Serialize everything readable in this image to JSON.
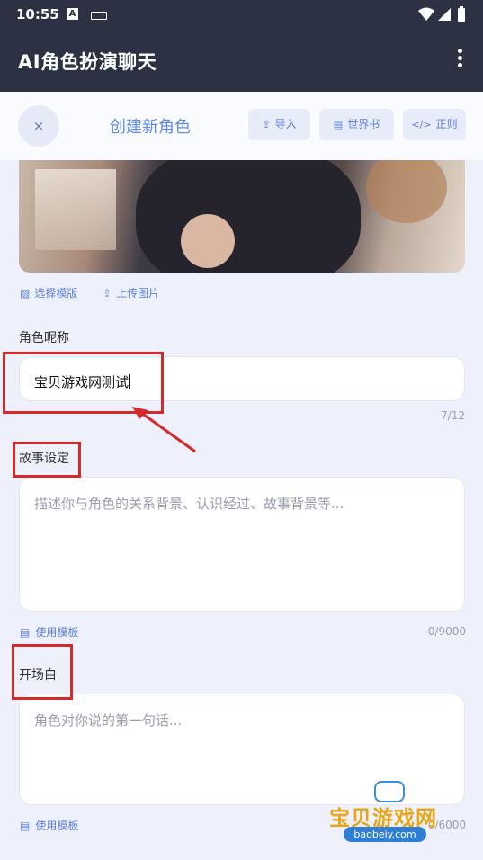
{
  "status": {
    "time": "10:55",
    "badge": "A"
  },
  "appbar": {
    "title": "AI角色扮演聊天"
  },
  "toolbar": {
    "close": "×",
    "title": "创建新角色",
    "import_label": "导入",
    "worldbook_label": "世界书",
    "regex_label": "正则"
  },
  "image_actions": {
    "choose_template": "选择模版",
    "upload": "上传图片"
  },
  "nickname": {
    "label": "角色昵称",
    "value": "宝贝游戏网测试",
    "counter": "7/12"
  },
  "story": {
    "label": "故事设定",
    "placeholder": "描述你与角色的关系背景、认识经过、故事背景等...",
    "counter": "0/9000",
    "template": "使用模板"
  },
  "opening": {
    "label": "开场白",
    "placeholder": "角色对你说的第一句话...",
    "counter": "0/6000",
    "template": "使用模板"
  },
  "watermark": {
    "text": "宝贝游戏网",
    "url": "baobeiy.com"
  },
  "colors": {
    "accent": "#5c7fd8",
    "appbar": "#2c3244",
    "highlight": "#d42a2a"
  }
}
